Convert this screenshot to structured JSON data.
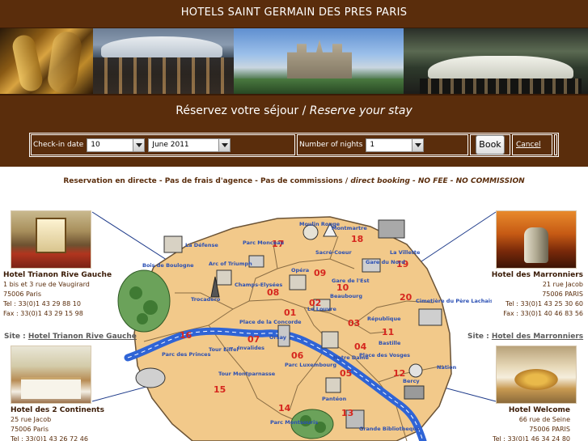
{
  "header": {
    "title": "HOTELS SAINT GERMAIN DES PRES PARIS"
  },
  "reservation": {
    "title_fr": "Réservez votre séjour / ",
    "title_en": "Reserve your stay",
    "checkin_label": "Check-in date",
    "checkin_day": "10",
    "checkin_month": "June 2011",
    "nights_label": "Number of nights",
    "nights_value": "1",
    "book_label": "Book",
    "cancel_label": "Cancel"
  },
  "notice": {
    "fr": "Reservation en directe - Pas de frais d'agence - Pas de commissions / ",
    "en": "direct booking - NO FEE - NO COMMISSION"
  },
  "hotels": {
    "trianon": {
      "name": "Hotel Trianon Rive Gauche",
      "address": "1 bis et 3 rue de Vaugirard",
      "city": "75006 Paris",
      "tel": "Tel : 33(0)1 43 29 88 10",
      "fax": "Fax : 33(0)1 43 29 15 98",
      "site_prefix": "Site : ",
      "site_link": "Hotel Trianon Rive Gauche"
    },
    "continents": {
      "name": "Hotel des 2 Continents",
      "address": "25 rue Jacob",
      "city": "75006 Paris",
      "tel": "Tel : 33(0)1 43 26 72 46"
    },
    "marronniers": {
      "name": "Hotel des Marronniers",
      "address": "21 rue Jacob",
      "city": "75006 PARIS",
      "tel": "Tel : 33(0)1 43 25 30 60",
      "fax": "Fax : 33(0)1 40 46 83 56",
      "site_prefix": "Site : ",
      "site_link": "Hotel des Marronniers"
    },
    "welcome": {
      "name": "Hotel Welcome",
      "address": "66 rue de Seine",
      "city": "75006 PARIS",
      "tel": "Tel : 33(0)1 46 34 24 80"
    }
  },
  "map": {
    "arrondissements": [
      "01",
      "02",
      "03",
      "04",
      "05",
      "06",
      "07",
      "08",
      "09",
      "10",
      "11",
      "12",
      "13",
      "14",
      "15",
      "16",
      "17",
      "18",
      "19",
      "20"
    ],
    "places": {
      "la_defense": "La Défense",
      "bois_boulogne": "Bois de Boulogne",
      "arc": "Arc of Triumph",
      "parc_monceau": "Parc Monceau",
      "moulin_rouge": "Moulin Rouge",
      "montmartre": "Montmartre",
      "sacre_coeur": "Sacré-Coeur",
      "la_villette": "La Villette",
      "opera": "Opéra",
      "gare_nord": "Gare du Nord",
      "gare_est": "Gare de l'Est",
      "beaubourg": "Beaubourg",
      "champs": "Champs-Elysées",
      "trocadero": "Trocadero",
      "louvre": "Le Louvre",
      "concorde": "Place de la Concorde",
      "republique": "République",
      "pere_lachaise": "Cimetière du Père Lachaise",
      "orsay": "Orsay",
      "invalides": "Invalides",
      "bastille": "Bastille",
      "tour_eiffel": "Tour Eiffel",
      "parc_princes": "Parc des Princes",
      "tour_montparnasse": "Tour Montparnasse",
      "notre_dame": "Notre Dame",
      "place_vosges": "Place des Vosges",
      "luxembourg": "Parc Luxembourg",
      "nation": "Nation",
      "bercy": "Bercy",
      "pantheon": "Pantéon",
      "montsouris": "Parc Montsouris",
      "bibliotheque": "Grande Bibliotheque"
    }
  },
  "colors": {
    "brown": "#5a2d0c",
    "map_land": "#f2c98a",
    "seine": "#2f64d6"
  }
}
